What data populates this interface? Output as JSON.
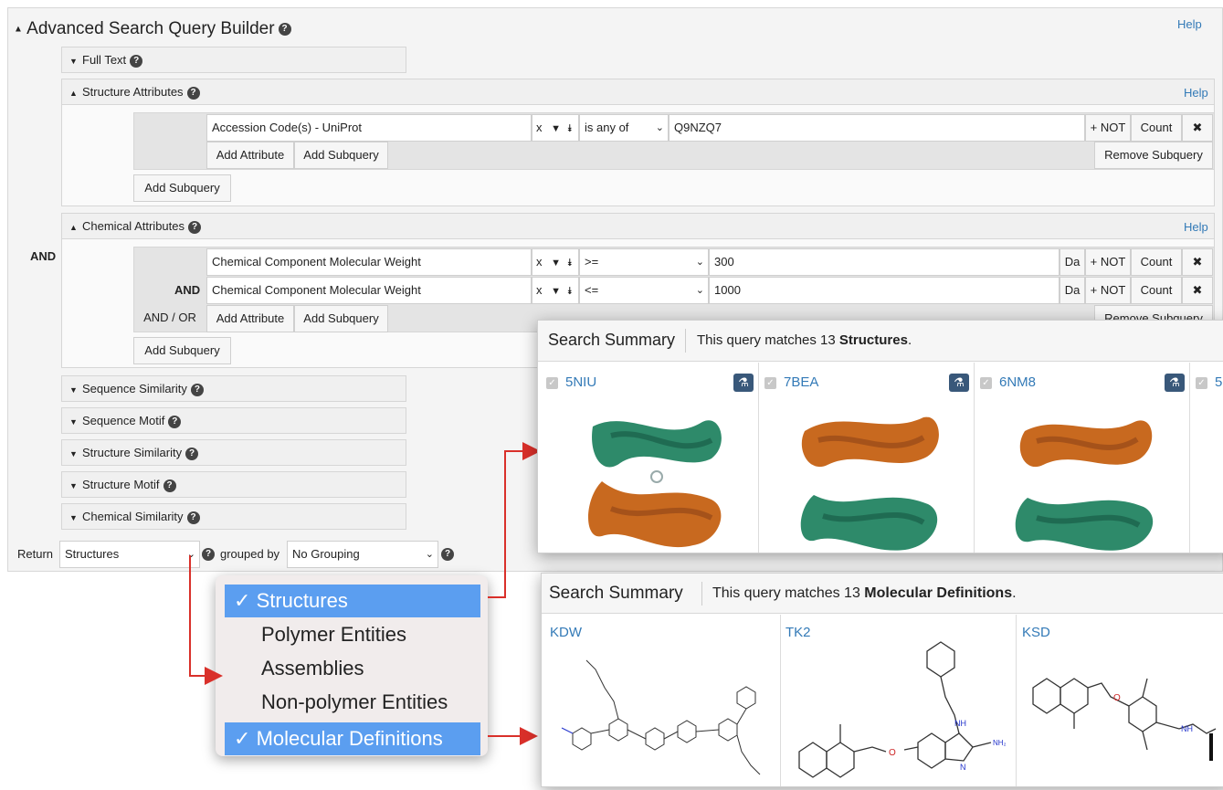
{
  "builder": {
    "title": "Advanced Search Query Builder",
    "help": "Help",
    "and_label": "AND",
    "sections": {
      "full_text": "Full Text",
      "structure_attributes": "Structure Attributes",
      "chemical_attributes": "Chemical Attributes",
      "sequence_similarity": "Sequence Similarity",
      "sequence_motif": "Sequence Motif",
      "structure_similarity": "Structure Similarity",
      "structure_motif": "Structure Motif",
      "chemical_similarity": "Chemical Similarity"
    },
    "structure_query": {
      "attribute": "Accession Code(s) - UniProt",
      "operator": "is any of",
      "value": "Q9NZQ7",
      "not": "+ NOT",
      "count": "Count",
      "close": "✖",
      "add_attribute": "Add Attribute",
      "add_subquery": "Add Subquery",
      "remove_subquery": "Remove Subquery",
      "outer_add_subquery": "Add Subquery",
      "help": "Help"
    },
    "chemical_query": {
      "help": "Help",
      "rows": [
        {
          "prefix": "",
          "attribute": "Chemical Component Molecular Weight",
          "operator": ">=",
          "value": "300",
          "unit": "Da",
          "not": "+ NOT",
          "count": "Count",
          "close": "✖"
        },
        {
          "prefix": "AND",
          "attribute": "Chemical Component Molecular Weight",
          "operator": "<=",
          "value": "1000",
          "unit": "Da",
          "not": "+ NOT",
          "count": "Count",
          "close": "✖"
        }
      ],
      "and_or": "AND / OR",
      "add_attribute": "Add Attribute",
      "add_subquery": "Add Subquery",
      "remove_subquery": "Remove Subquery",
      "outer_add_subquery": "Add Subquery"
    },
    "return": {
      "label": "Return",
      "value": "Structures",
      "grouped_by_label": "grouped by",
      "grouping": "No Grouping"
    },
    "x": "x"
  },
  "dropdown": {
    "options": [
      {
        "label": "Structures",
        "selected": true
      },
      {
        "label": "Polymer Entities",
        "selected": false
      },
      {
        "label": "Assemblies",
        "selected": false
      },
      {
        "label": "Non-polymer Entities",
        "selected": false
      },
      {
        "label": "Molecular Definitions",
        "selected": true
      }
    ],
    "check": "✓"
  },
  "summary_structures": {
    "title": "Search Summary",
    "text_prefix": "This query matches 13 ",
    "text_bold": "Structures",
    "text_suffix": ".",
    "cards": [
      {
        "id": "5NIU",
        "top_color": "#2e8a6a",
        "bottom_color": "#c8691f"
      },
      {
        "id": "7BEA",
        "top_color": "#c8691f",
        "bottom_color": "#2e8a6a"
      },
      {
        "id": "6NM8",
        "top_color": "#c8691f",
        "bottom_color": "#2e8a6a"
      },
      {
        "id": "5"
      }
    ]
  },
  "summary_molecules": {
    "title": "Search Summary",
    "text_prefix": "This query matches 13 ",
    "text_bold": "Molecular Definitions",
    "text_suffix": ".",
    "cards": [
      {
        "id": "KDW"
      },
      {
        "id": "TK2"
      },
      {
        "id": "KSD"
      }
    ],
    "nh_label": "NH",
    "n_label": "N",
    "nh2_label": "NH₂",
    "o_label": "O"
  },
  "colors": {
    "link": "#337ab7",
    "dropdown_selected": "#5b9ef0",
    "arrow": "#d9302a",
    "flask": "#39587a"
  }
}
